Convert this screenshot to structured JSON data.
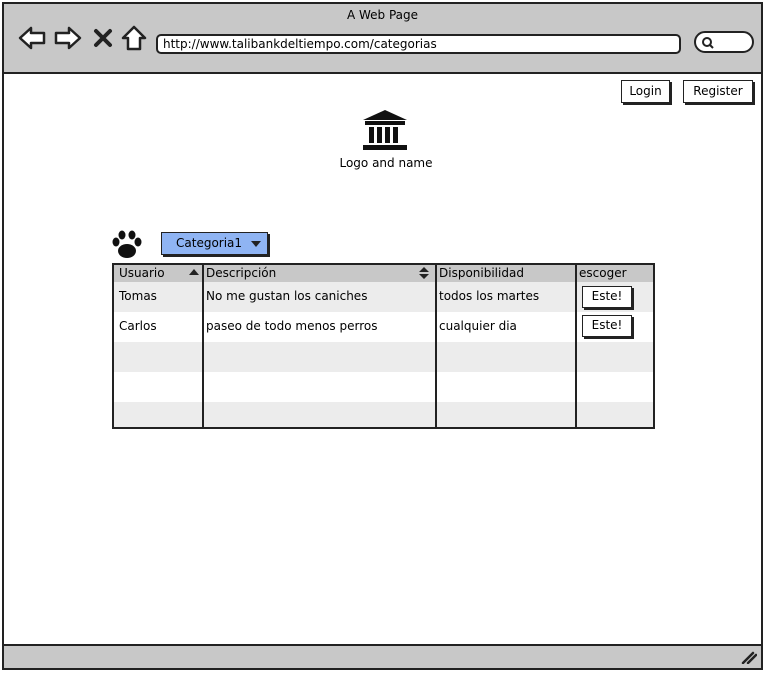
{
  "window": {
    "title": "A Web Page"
  },
  "browser": {
    "url": "http://www.talibankdeltiempo.com/categorias",
    "icons": [
      "back-arrow-icon",
      "forward-arrow-icon",
      "close-x-icon",
      "home-icon",
      "search-icon"
    ]
  },
  "header": {
    "login_label": "Login",
    "register_label": "Register"
  },
  "logo": {
    "icon": "bank-building-icon",
    "text": "Logo and name"
  },
  "category": {
    "icon": "paw-icon",
    "selected": "Categoria1"
  },
  "table": {
    "columns": [
      "Usuario",
      "Descripción",
      "Disponibilidad",
      "escoger"
    ],
    "rows": [
      {
        "usuario": "Tomas",
        "descripcion": "No me gustan los caniches",
        "disponibilidad": "todos los martes",
        "action": "Este!"
      },
      {
        "usuario": "Carlos",
        "descripcion": "paseo de todo menos perros",
        "disponibilidad": "cualquier dia",
        "action": "Este!"
      }
    ]
  }
}
